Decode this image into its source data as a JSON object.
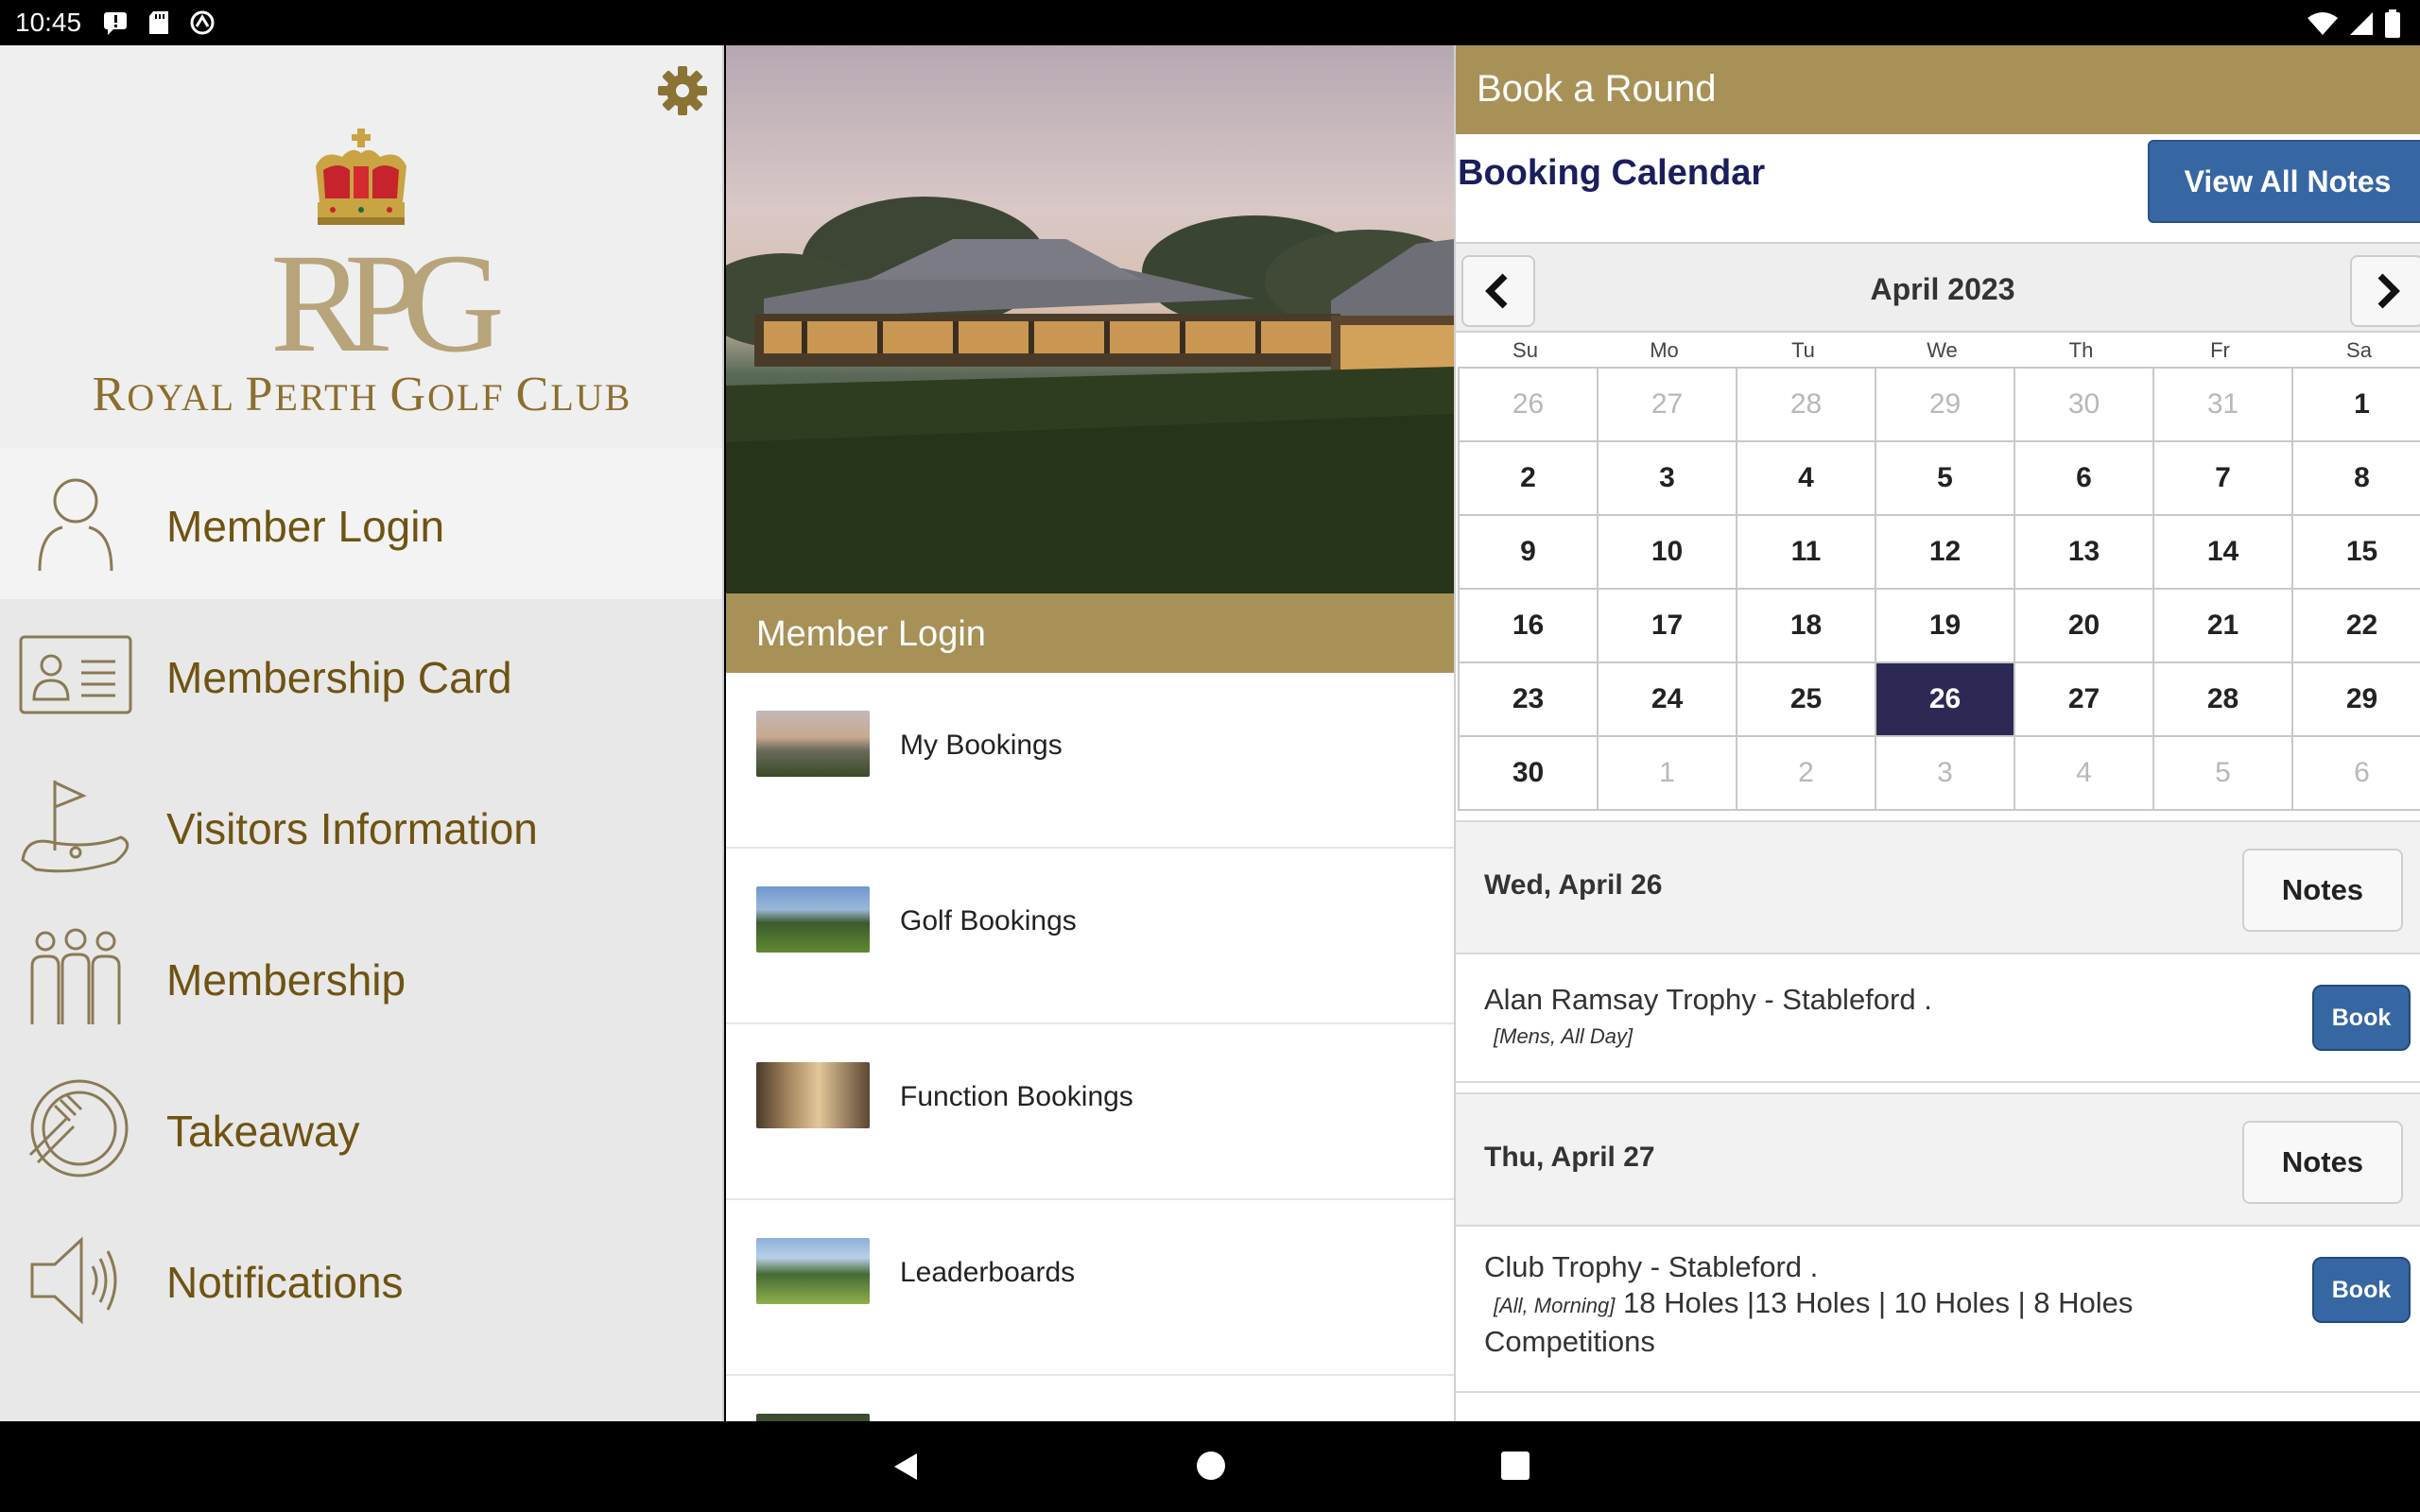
{
  "status": {
    "time": "10:45"
  },
  "sidebar": {
    "club_name_line": "Royal Perth Golf Club",
    "club_name_parts": [
      "R",
      "OYAL ",
      "P",
      "ERTH ",
      "G",
      "OLF ",
      "C",
      "LUB"
    ],
    "monogram": "RPG",
    "items": [
      {
        "label": "Member Login",
        "icon": "person-icon"
      },
      {
        "label": "Membership Card",
        "icon": "id-card-icon"
      },
      {
        "label": "Visitors Information",
        "icon": "golf-flag-icon"
      },
      {
        "label": "Membership",
        "icon": "group-icon"
      },
      {
        "label": "Takeaway",
        "icon": "takeaway-icon"
      },
      {
        "label": "Notifications",
        "icon": "megaphone-icon"
      }
    ]
  },
  "middle": {
    "header": "Member Login",
    "items": [
      {
        "label": "My Bookings"
      },
      {
        "label": "Golf Bookings"
      },
      {
        "label": "Function Bookings"
      },
      {
        "label": "Leaderboards"
      }
    ]
  },
  "right": {
    "header": "Book a Round",
    "calendar_title": "Booking Calendar",
    "view_all_notes": "View All Notes",
    "month": "April 2023",
    "weekdays": [
      "Su",
      "Mo",
      "Tu",
      "We",
      "Th",
      "Fr",
      "Sa"
    ],
    "days": [
      [
        "26",
        "27",
        "28",
        "29",
        "30",
        "31",
        "1"
      ],
      [
        "2",
        "3",
        "4",
        "5",
        "6",
        "7",
        "8"
      ],
      [
        "9",
        "10",
        "11",
        "12",
        "13",
        "14",
        "15"
      ],
      [
        "16",
        "17",
        "18",
        "19",
        "20",
        "21",
        "22"
      ],
      [
        "23",
        "24",
        "25",
        "26",
        "27",
        "28",
        "29"
      ],
      [
        "30",
        "1",
        "2",
        "3",
        "4",
        "5",
        "6"
      ]
    ],
    "selected_day": "26",
    "events": [
      {
        "date": "Wed, April 26",
        "notes_label": "Notes",
        "title": "Alan Ramsay Trophy - Stableford .",
        "tag": "[Mens, All Day]",
        "extra": "",
        "book_label": "Book"
      },
      {
        "date": "Thu, April 27",
        "notes_label": "Notes",
        "title": "Club Trophy - Stableford .",
        "tag": "[All, Morning]",
        "extra": "18 Holes |13 Holes | 10 Holes | 8 Holes Competitions",
        "book_label": "Book"
      }
    ]
  },
  "colors": {
    "gold": "#a89157",
    "gold_text": "#6f5312",
    "navy": "#1b1e5c",
    "button_blue": "#3767a3",
    "selected_day": "#2c2a55"
  }
}
